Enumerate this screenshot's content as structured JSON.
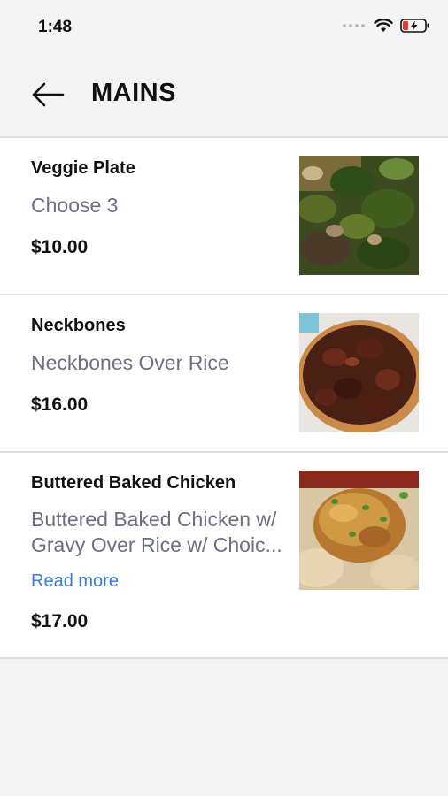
{
  "status": {
    "time": "1:48"
  },
  "header": {
    "title": "MAINS"
  },
  "items": [
    {
      "name": "Veggie Plate",
      "desc_line1": "Choose 3",
      "desc_line2": "",
      "price": "$10.00",
      "read_more": "",
      "image": "greens-plate-photo"
    },
    {
      "name": "Neckbones",
      "desc_line1": "Neckbones Over Rice",
      "desc_line2": "",
      "price": "$16.00",
      "read_more": "",
      "image": "neckbones-bowl-photo"
    },
    {
      "name": "Buttered Baked Chicken",
      "desc_line1": "Buttered Baked Chicken w/",
      "desc_line2": "Gravy Over Rice w/ Choic...",
      "price": "$17.00",
      "read_more": "Read more",
      "image": "baked-chicken-photo"
    }
  ],
  "colors": {
    "accent_link": "#3a7bd5",
    "desc_text": "#6b6f80",
    "background": "#f4f4f4"
  }
}
